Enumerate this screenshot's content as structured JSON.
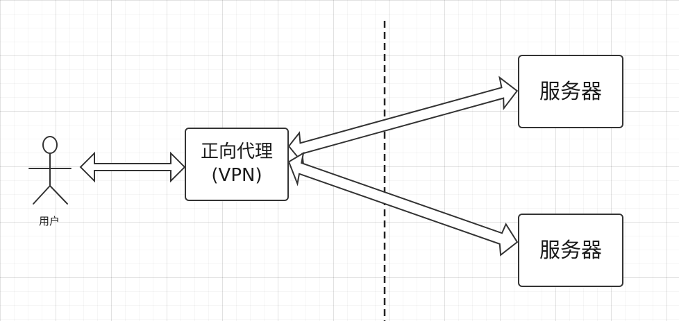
{
  "actor": {
    "label": "用户"
  },
  "proxy": {
    "title": "正向代理",
    "subtitle": "(VPN)"
  },
  "servers": [
    {
      "label": "服务器"
    },
    {
      "label": "服务器"
    }
  ]
}
